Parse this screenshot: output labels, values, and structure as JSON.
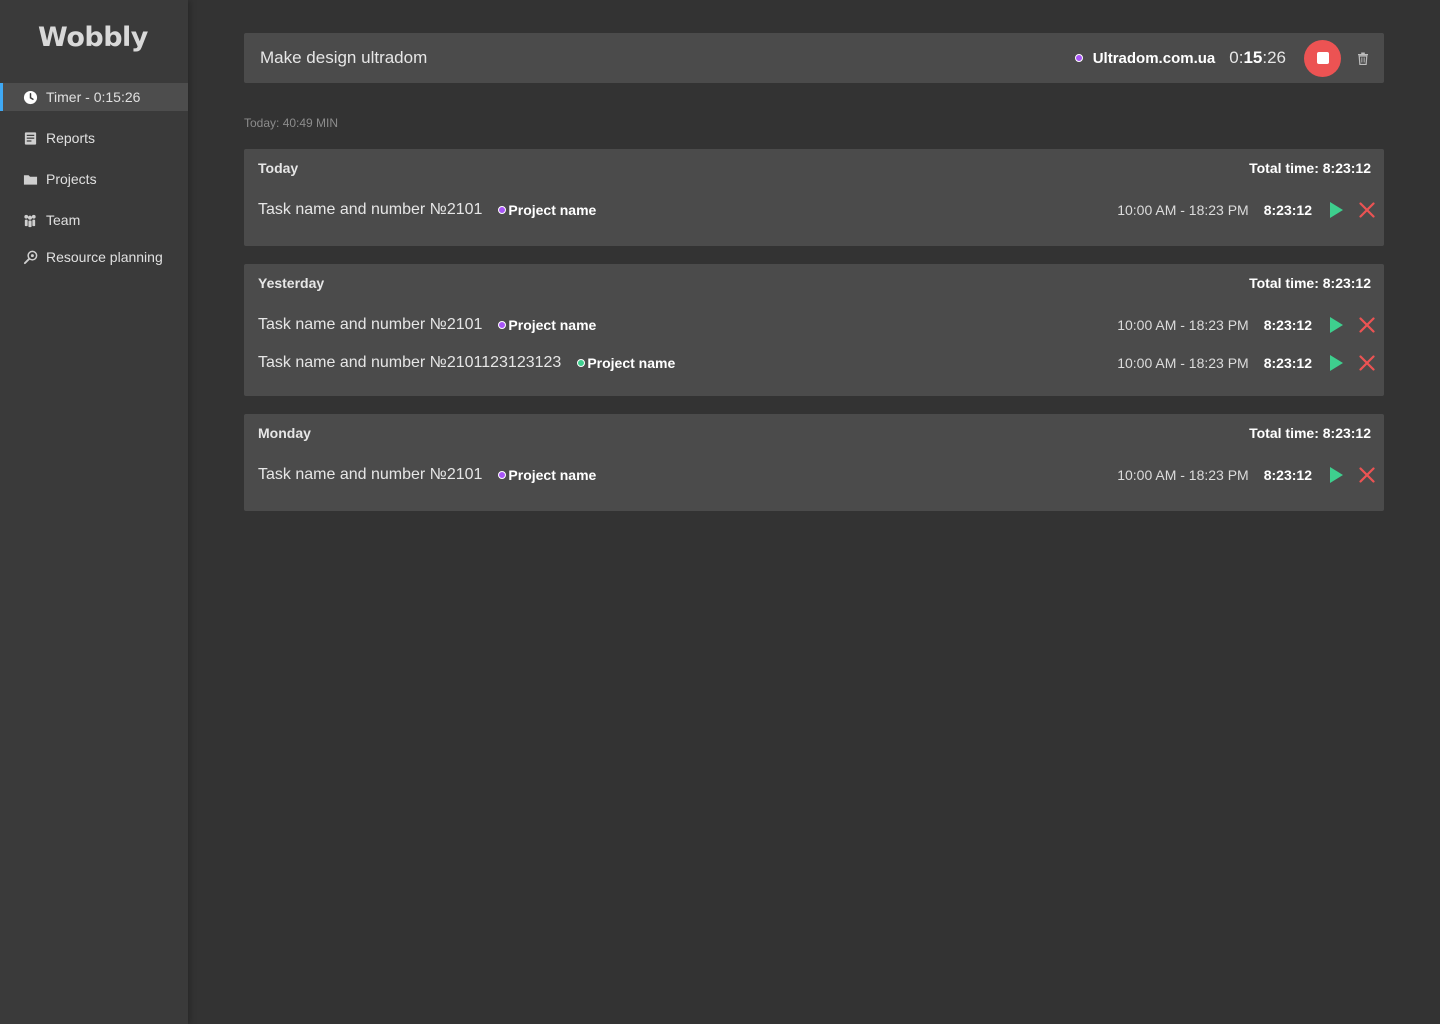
{
  "app": {
    "logo": "Wobbly"
  },
  "sidebar": {
    "items": [
      {
        "label": "Timer - 0:15:26",
        "icon": "clock-icon",
        "active": true
      },
      {
        "label": "Reports",
        "icon": "reports-icon"
      },
      {
        "label": "Projects",
        "icon": "folder-icon"
      },
      {
        "label": "Team",
        "icon": "team-icon"
      },
      {
        "label": "Resource planning",
        "icon": "resource-planning-icon"
      }
    ]
  },
  "timer": {
    "task": "Make design ultradom",
    "project": "Ultradom.com.ua",
    "project_color": "#a855f7",
    "clock_prefix": "0:",
    "clock_minutes": "15",
    "clock_suffix": ":26",
    "stop_color": "#ec5353"
  },
  "summary": {
    "today": "Today: 40:49 MIN"
  },
  "days": [
    {
      "label": "Today",
      "total": "Total time: 8:23:12",
      "entries": [
        {
          "name": "Task name and number №2101",
          "project": "Project name",
          "project_color": "#a855f7",
          "range": "10:00 AM - 18:23 PM",
          "duration": "8:23:12"
        }
      ]
    },
    {
      "label": "Yesterday",
      "total": "Total time: 8:23:12",
      "entries": [
        {
          "name": "Task name and number №2101",
          "project": "Project name",
          "project_color": "#a855f7",
          "range": "10:00 AM - 18:23 PM",
          "duration": "8:23:12"
        },
        {
          "name": "Task name and number №2101123123123",
          "project": "Project name",
          "project_color": "#3ecf8e",
          "range": "10:00 AM - 18:23 PM",
          "duration": "8:23:12"
        }
      ]
    },
    {
      "label": "Monday",
      "total": "Total time: 8:23:12",
      "entries": [
        {
          "name": "Task name and number №2101",
          "project": "Project name",
          "project_color": "#a855f7",
          "range": "10:00 AM - 18:23 PM",
          "duration": "8:23:12"
        }
      ]
    }
  ],
  "colors": {
    "play": "#3ecf8e",
    "delete": "#ec5353",
    "active_accent": "#3fa9f5"
  }
}
